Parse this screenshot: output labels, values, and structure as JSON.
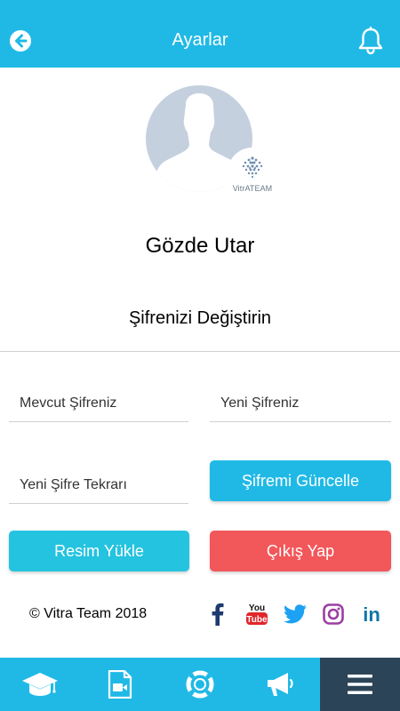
{
  "header": {
    "title": "Ayarlar",
    "back_icon": "back-arrow-icon",
    "notification_icon": "bell-icon"
  },
  "profile": {
    "name": "Gözde Utar",
    "avatar_icon": "user-silhouette-icon",
    "badge_text": "VitrATEAM"
  },
  "password_section": {
    "title": "Şifrenizi Değiştirin",
    "current_placeholder": "Mevcut Şifreniz",
    "new_placeholder": "Yeni Şifreniz",
    "repeat_placeholder": "Yeni Şifre Tekrarı",
    "update_label": "Şifremi Güncelle"
  },
  "actions": {
    "upload_label": "Resim Yükle",
    "logout_label": "Çıkış Yap"
  },
  "footer": {
    "copyright": "© Vitra Team 2018",
    "social": [
      "facebook-icon",
      "youtube-icon",
      "twitter-icon",
      "instagram-icon",
      "linkedin-icon"
    ]
  },
  "tabbar": {
    "items": [
      "graduation-cap-icon",
      "video-file-icon",
      "lifebuoy-icon",
      "megaphone-icon",
      "menu-icon"
    ],
    "active_index": 4
  },
  "colors": {
    "primary": "#20b9e6",
    "upload": "#24c3e0",
    "logout": "#f2575a",
    "tab_active": "#2c4457",
    "avatar": "#c5d0df"
  }
}
